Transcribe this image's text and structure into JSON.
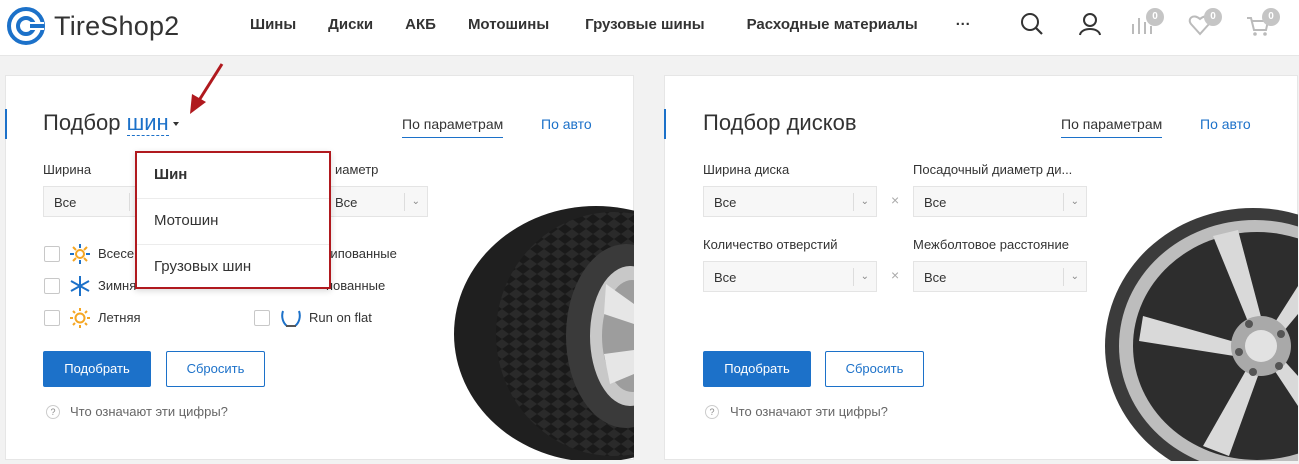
{
  "header": {
    "logo_text": "TireShop2",
    "nav": [
      "Шины",
      "Диски",
      "АКБ",
      "Мотошины",
      "Грузовые шины",
      "Расходные материалы"
    ],
    "more": "···",
    "compare_count": "0",
    "favorites_count": "0",
    "cart_count": "0"
  },
  "tires": {
    "title_prefix": "Подбор",
    "title_link": "шин",
    "tab_params": "По параметрам",
    "tab_auto": "По авто",
    "width_label": "Ширина",
    "diameter_label": "иаметр",
    "width_value": "Все",
    "diameter_value": "Все",
    "seasons": [
      {
        "label": "Всесе"
      },
      {
        "label": "Зимня"
      },
      {
        "label": "Летняя"
      }
    ],
    "spikes": [
      {
        "label": "шипованные"
      },
      {
        "label": "пованные"
      },
      {
        "label": "Run on flat"
      }
    ],
    "submit": "Подобрать",
    "reset": "Сбросить",
    "help": "Что означают эти цифры?",
    "help_icon": "?"
  },
  "dropdown": {
    "items": [
      "Шин",
      "Мотошин",
      "Грузовых шин"
    ]
  },
  "disks": {
    "title": "Подбор дисков",
    "tab_params": "По параметрам",
    "tab_auto": "По авто",
    "width_label": "Ширина диска",
    "seat_label": "Посадочный диаметр ди...",
    "holes_label": "Количество отверстий",
    "bolt_label": "Межболтовое расстояние",
    "width_value": "Все",
    "seat_value": "Все",
    "holes_value": "Все",
    "bolt_value": "Все",
    "times": "×",
    "submit": "Подобрать",
    "reset": "Сбросить",
    "help": "Что означают эти цифры?",
    "help_icon": "?"
  },
  "colors": {
    "accent": "#1c71c9",
    "highlight": "#b0191e"
  }
}
